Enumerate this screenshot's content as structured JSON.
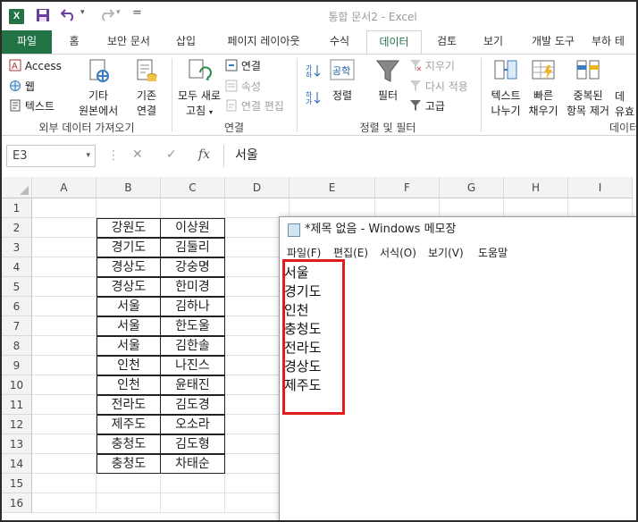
{
  "app": {
    "logo": "X",
    "title": "통합 문서2 - Excel"
  },
  "quick_access": {
    "save_icon": "save-icon",
    "undo_icon": "undo-icon",
    "redo_icon": "redo-icon",
    "more": "="
  },
  "tabs": [
    "파일",
    "홈",
    "보안 문서",
    "삽입",
    "페이지 레이아웃",
    "수식",
    "데이터",
    "검토",
    "보기",
    "개발 도구",
    "부하 테"
  ],
  "active_tab": "데이터",
  "ribbon": {
    "access": "Access",
    "web": "웹",
    "text": "텍스트",
    "other_sources": [
      "기타",
      "원본에서"
    ],
    "existing": [
      "기존",
      "연결"
    ],
    "refresh_all": [
      "모두 새로",
      "고침"
    ],
    "connections": "연결",
    "properties": "속성",
    "edit_links": "연결 편집",
    "sort": "정렬",
    "filter": "필터",
    "clear": "지우기",
    "reapply": "다시 적용",
    "advanced": "고급",
    "text_to_columns": [
      "텍스트",
      "나누기"
    ],
    "flash_fill": [
      "빠른",
      "채우기"
    ],
    "remove_duplicates": [
      "중복된",
      "항목 제거"
    ],
    "data_validation": [
      "데",
      "유효"
    ],
    "groups": {
      "external": "외부 데이터 가져오기",
      "conn": "연결",
      "sort_filter": "정렬 및 필터",
      "data_tools": "데이터"
    }
  },
  "formula_bar": {
    "name_box": "E3",
    "fx": "fx",
    "value": "서울"
  },
  "columns": [
    "A",
    "B",
    "C",
    "D",
    "E",
    "F",
    "G",
    "H",
    "I"
  ],
  "rows": [
    "1",
    "2",
    "3",
    "4",
    "5",
    "6",
    "7",
    "8",
    "9",
    "10",
    "11",
    "12",
    "13",
    "14",
    "15",
    "16"
  ],
  "table": [
    [
      "강원도",
      "이상원"
    ],
    [
      "경기도",
      "김둘리"
    ],
    [
      "경상도",
      "강숭명"
    ],
    [
      "경상도",
      "한미경"
    ],
    [
      "서울",
      "김하나"
    ],
    [
      "서울",
      "한도울"
    ],
    [
      "서울",
      "김한솔"
    ],
    [
      "인천",
      "나진스"
    ],
    [
      "인천",
      "윤태진"
    ],
    [
      "전라도",
      "김도경"
    ],
    [
      "제주도",
      "오소라"
    ],
    [
      "충청도",
      "김도형"
    ],
    [
      "충청도",
      "차태순"
    ]
  ],
  "notepad": {
    "title": "*제목 없음 - Windows 메모장",
    "menu": [
      "파일(F)",
      "편집(E)",
      "서식(O)",
      "보기(V)",
      "도움말"
    ],
    "lines": [
      "서울",
      "경기도",
      "인천",
      "충청도",
      "전라도",
      "경상도",
      "제주도"
    ]
  },
  "colors": {
    "excel_green": "#217346",
    "highlight": "#e01c1c"
  }
}
